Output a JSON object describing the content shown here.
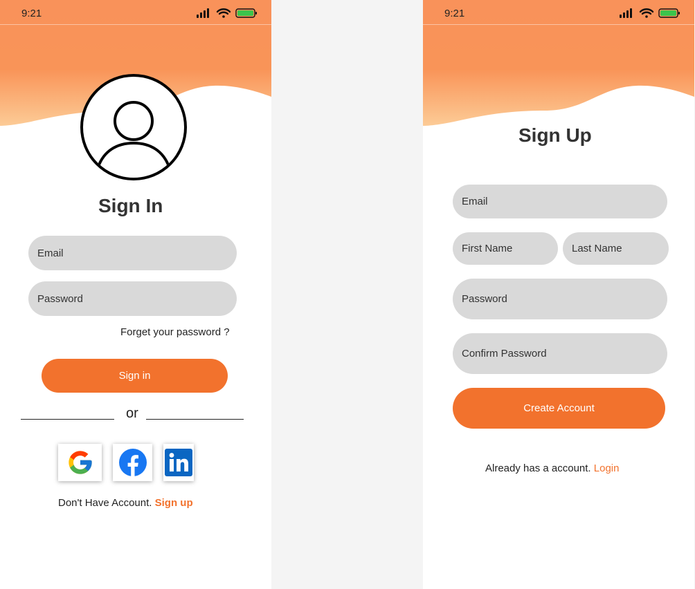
{
  "status_bar": {
    "time": "9:21"
  },
  "signin": {
    "title": "Sign In",
    "email_placeholder": "Email",
    "password_placeholder": "Password",
    "forgot_password": "Forget your password ?",
    "signin_button": "Sign in",
    "or_text": "or",
    "social": [
      "google-icon",
      "facebook-icon",
      "linkedin-icon"
    ],
    "no_account_text": "Don't Have Account.",
    "signup_link": "Sign up"
  },
  "signup": {
    "title": "Sign Up",
    "email_placeholder": "Email",
    "first_name_placeholder": "First Name",
    "last_name_placeholder": "Last Name",
    "password_placeholder": "Password",
    "confirm_password_placeholder": "Confirm Password",
    "create_button": "Create Account",
    "has_account_text": "Already has a account.",
    "login_link": "Login"
  },
  "colors": {
    "accent": "#f2722d",
    "field": "#d9d9d9",
    "wave_top": "#f9925a",
    "wave_bottom": "#fbbd8c"
  }
}
